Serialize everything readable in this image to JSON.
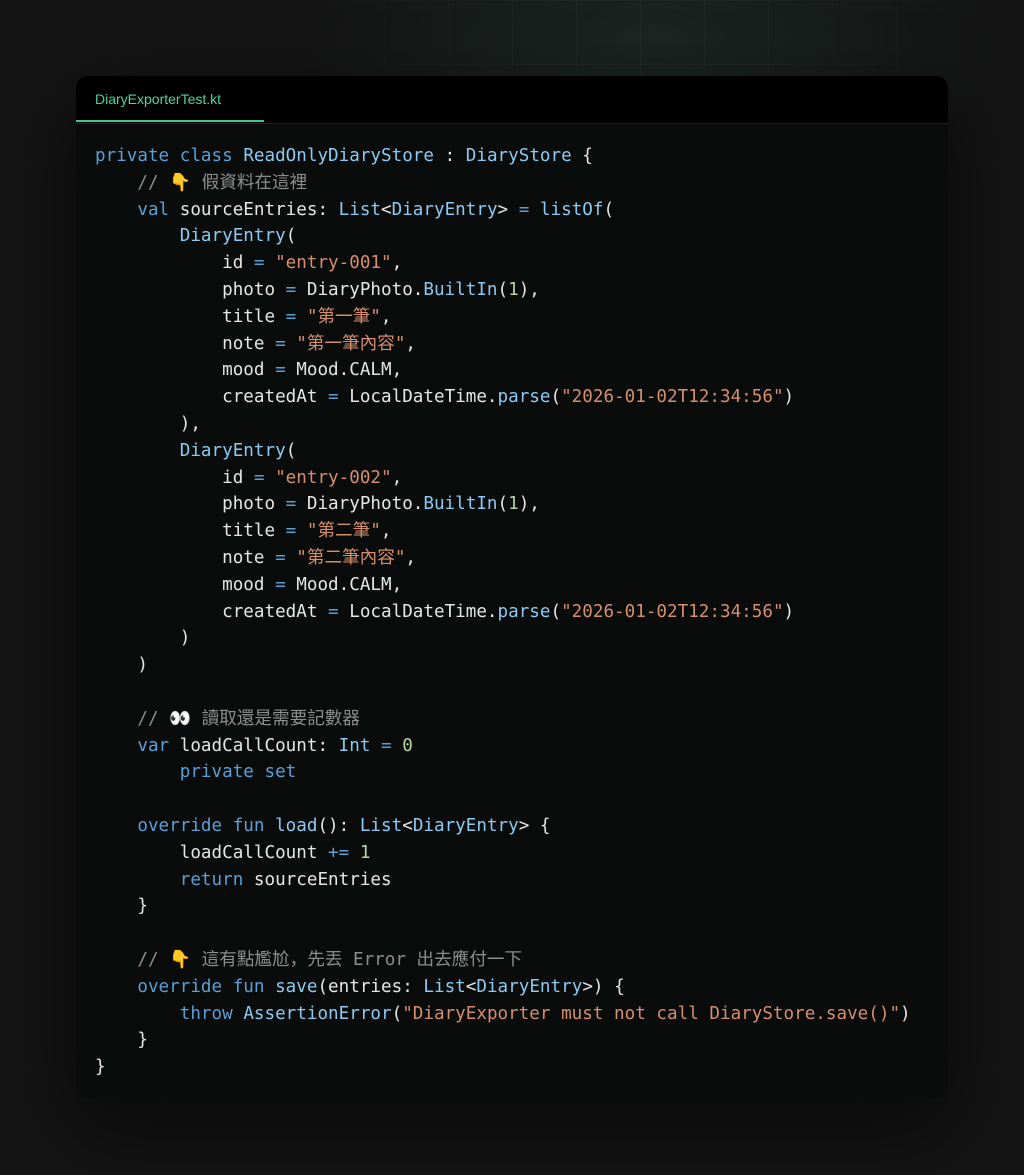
{
  "tab": {
    "filename": "DiaryExporterTest.kt"
  },
  "code": {
    "lines": [
      [
        [
          "kw",
          "private"
        ],
        [
          "id",
          " "
        ],
        [
          "kw",
          "class"
        ],
        [
          "id",
          " "
        ],
        [
          "ty",
          "ReadOnlyDiaryStore"
        ],
        [
          "id",
          " : "
        ],
        [
          "ty",
          "DiaryStore"
        ],
        [
          "id",
          " {"
        ]
      ],
      [
        [
          "id",
          "    "
        ],
        [
          "cm",
          "// 👇 假資料在這裡"
        ]
      ],
      [
        [
          "id",
          "    "
        ],
        [
          "kw",
          "val"
        ],
        [
          "id",
          " sourceEntries: "
        ],
        [
          "ty",
          "List"
        ],
        [
          "id",
          "<"
        ],
        [
          "ty",
          "DiaryEntry"
        ],
        [
          "id",
          "> "
        ],
        [
          "op",
          "="
        ],
        [
          "id",
          " "
        ],
        [
          "fn",
          "listOf"
        ],
        [
          "id",
          "("
        ]
      ],
      [
        [
          "id",
          "        "
        ],
        [
          "ty",
          "DiaryEntry"
        ],
        [
          "id",
          "("
        ]
      ],
      [
        [
          "id",
          "            id "
        ],
        [
          "op",
          "="
        ],
        [
          "id",
          " "
        ],
        [
          "str",
          "\"entry-001\""
        ],
        [
          "id",
          ","
        ]
      ],
      [
        [
          "id",
          "            photo "
        ],
        [
          "op",
          "="
        ],
        [
          "id",
          " DiaryPhoto."
        ],
        [
          "ty",
          "BuiltIn"
        ],
        [
          "id",
          "("
        ],
        [
          "num",
          "1"
        ],
        [
          "id",
          "),"
        ]
      ],
      [
        [
          "id",
          "            title "
        ],
        [
          "op",
          "="
        ],
        [
          "id",
          " "
        ],
        [
          "str",
          "\"第一筆\""
        ],
        [
          "id",
          ","
        ]
      ],
      [
        [
          "id",
          "            note "
        ],
        [
          "op",
          "="
        ],
        [
          "id",
          " "
        ],
        [
          "str",
          "\"第一筆內容\""
        ],
        [
          "id",
          ","
        ]
      ],
      [
        [
          "id",
          "            mood "
        ],
        [
          "op",
          "="
        ],
        [
          "id",
          " Mood.CALM,"
        ]
      ],
      [
        [
          "id",
          "            createdAt "
        ],
        [
          "op",
          "="
        ],
        [
          "id",
          " LocalDateTime."
        ],
        [
          "fn",
          "parse"
        ],
        [
          "id",
          "("
        ],
        [
          "str",
          "\"2026-01-02T12:34:56\""
        ],
        [
          "id",
          ")"
        ]
      ],
      [
        [
          "id",
          "        ),"
        ]
      ],
      [
        [
          "id",
          "        "
        ],
        [
          "ty",
          "DiaryEntry"
        ],
        [
          "id",
          "("
        ]
      ],
      [
        [
          "id",
          "            id "
        ],
        [
          "op",
          "="
        ],
        [
          "id",
          " "
        ],
        [
          "str",
          "\"entry-002\""
        ],
        [
          "id",
          ","
        ]
      ],
      [
        [
          "id",
          "            photo "
        ],
        [
          "op",
          "="
        ],
        [
          "id",
          " DiaryPhoto."
        ],
        [
          "ty",
          "BuiltIn"
        ],
        [
          "id",
          "("
        ],
        [
          "num",
          "1"
        ],
        [
          "id",
          "),"
        ]
      ],
      [
        [
          "id",
          "            title "
        ],
        [
          "op",
          "="
        ],
        [
          "id",
          " "
        ],
        [
          "str",
          "\"第二筆\""
        ],
        [
          "id",
          ","
        ]
      ],
      [
        [
          "id",
          "            note "
        ],
        [
          "op",
          "="
        ],
        [
          "id",
          " "
        ],
        [
          "str",
          "\"第二筆內容\""
        ],
        [
          "id",
          ","
        ]
      ],
      [
        [
          "id",
          "            mood "
        ],
        [
          "op",
          "="
        ],
        [
          "id",
          " Mood.CALM,"
        ]
      ],
      [
        [
          "id",
          "            createdAt "
        ],
        [
          "op",
          "="
        ],
        [
          "id",
          " LocalDateTime."
        ],
        [
          "fn",
          "parse"
        ],
        [
          "id",
          "("
        ],
        [
          "str",
          "\"2026-01-02T12:34:56\""
        ],
        [
          "id",
          ")"
        ]
      ],
      [
        [
          "id",
          "        )"
        ]
      ],
      [
        [
          "id",
          "    )"
        ]
      ],
      [],
      [
        [
          "id",
          "    "
        ],
        [
          "cm",
          "// 👀 讀取還是需要記數器"
        ]
      ],
      [
        [
          "id",
          "    "
        ],
        [
          "kw",
          "var"
        ],
        [
          "id",
          " loadCallCount: "
        ],
        [
          "ty",
          "Int"
        ],
        [
          "id",
          " "
        ],
        [
          "op",
          "="
        ],
        [
          "id",
          " "
        ],
        [
          "num",
          "0"
        ]
      ],
      [
        [
          "id",
          "        "
        ],
        [
          "kw",
          "private"
        ],
        [
          "id",
          " "
        ],
        [
          "kw",
          "set"
        ]
      ],
      [],
      [
        [
          "id",
          "    "
        ],
        [
          "kw",
          "override"
        ],
        [
          "id",
          " "
        ],
        [
          "kw",
          "fun"
        ],
        [
          "id",
          " "
        ],
        [
          "fn",
          "load"
        ],
        [
          "id",
          "(): "
        ],
        [
          "ty",
          "List"
        ],
        [
          "id",
          "<"
        ],
        [
          "ty",
          "DiaryEntry"
        ],
        [
          "id",
          "> {"
        ]
      ],
      [
        [
          "id",
          "        loadCallCount "
        ],
        [
          "op",
          "+="
        ],
        [
          "id",
          " "
        ],
        [
          "num",
          "1"
        ]
      ],
      [
        [
          "id",
          "        "
        ],
        [
          "kw",
          "return"
        ],
        [
          "id",
          " sourceEntries"
        ]
      ],
      [
        [
          "id",
          "    }"
        ]
      ],
      [],
      [
        [
          "id",
          "    "
        ],
        [
          "cm",
          "// 👇 這有點尷尬，先丟 Error 出去應付一下"
        ]
      ],
      [
        [
          "id",
          "    "
        ],
        [
          "kw",
          "override"
        ],
        [
          "id",
          " "
        ],
        [
          "kw",
          "fun"
        ],
        [
          "id",
          " "
        ],
        [
          "fn",
          "save"
        ],
        [
          "id",
          "(entries: "
        ],
        [
          "ty",
          "List"
        ],
        [
          "id",
          "<"
        ],
        [
          "ty",
          "DiaryEntry"
        ],
        [
          "id",
          ">) {"
        ]
      ],
      [
        [
          "id",
          "        "
        ],
        [
          "kw",
          "throw"
        ],
        [
          "id",
          " "
        ],
        [
          "fn",
          "AssertionError"
        ],
        [
          "id",
          "("
        ],
        [
          "str",
          "\"DiaryExporter must not call DiaryStore.save()\""
        ],
        [
          "id",
          ")"
        ]
      ],
      [
        [
          "id",
          "    }"
        ]
      ],
      [
        [
          "id",
          "}"
        ]
      ]
    ]
  }
}
